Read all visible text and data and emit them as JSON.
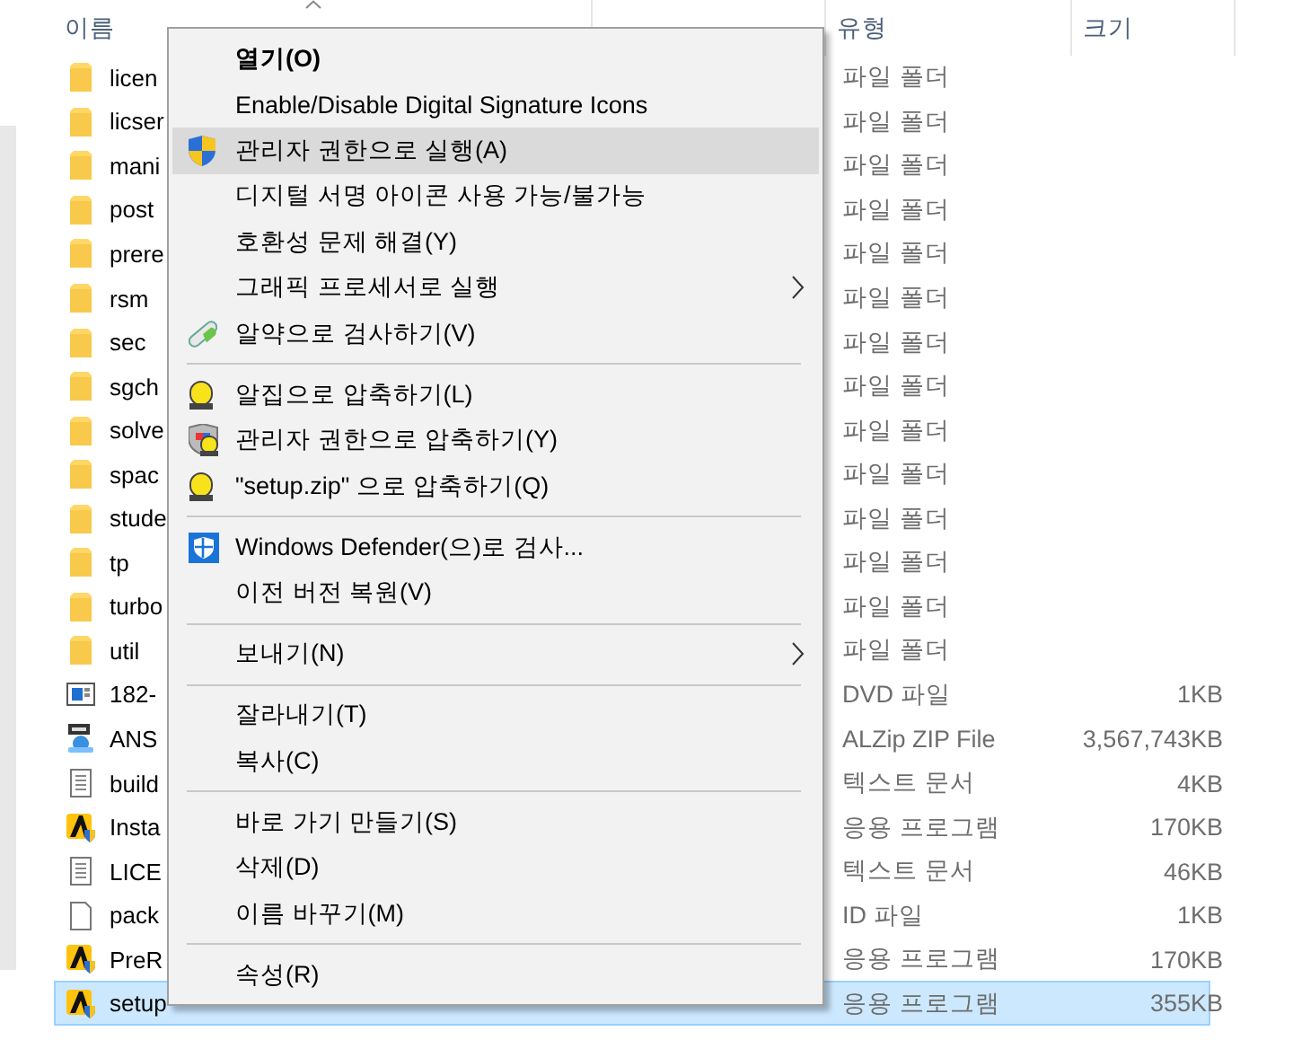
{
  "columns": [
    {
      "kind": "name",
      "label": "이름",
      "sorted": true
    },
    {
      "kind": "date",
      "sorted": false
    },
    {
      "kind": "type",
      "label": "유형",
      "sorted": false
    },
    {
      "kind": "size",
      "label": "크기",
      "sorted": false
    }
  ],
  "files": [
    {
      "name": "licen",
      "kind": "folder",
      "type": "파일 폴더",
      "selected": false
    },
    {
      "name": "licser",
      "kind": "folder",
      "type": "파일 폴더",
      "selected": false
    },
    {
      "name": "mani",
      "kind": "folder",
      "type": "파일 폴더",
      "selected": false
    },
    {
      "name": "post",
      "kind": "folder",
      "type": "파일 폴더",
      "selected": false
    },
    {
      "name": "prere",
      "kind": "folder",
      "type": "파일 폴더",
      "selected": false
    },
    {
      "name": "rsm",
      "kind": "folder",
      "type": "파일 폴더",
      "selected": false
    },
    {
      "name": "sec",
      "kind": "folder",
      "type": "파일 폴더",
      "selected": false
    },
    {
      "name": "sgch",
      "kind": "folder",
      "type": "파일 폴더",
      "selected": false
    },
    {
      "name": "solve",
      "kind": "folder",
      "type": "파일 폴더",
      "selected": false
    },
    {
      "name": "spac",
      "kind": "folder",
      "type": "파일 폴더",
      "selected": false
    },
    {
      "name": "stude",
      "kind": "folder",
      "type": "파일 폴더",
      "selected": false
    },
    {
      "name": "tp",
      "kind": "folder",
      "type": "파일 폴더",
      "selected": false
    },
    {
      "name": "turbo",
      "kind": "folder",
      "type": "파일 폴더",
      "selected": false
    },
    {
      "name": "util",
      "kind": "folder",
      "type": "파일 폴더",
      "selected": false
    },
    {
      "name": "182-",
      "kind": "dvd",
      "type": "DVD 파일",
      "size": "1KB",
      "selected": false
    },
    {
      "name": "ANS",
      "kind": "zip",
      "type": "ALZip ZIP File",
      "size": "3,567,743KB",
      "selected": false
    },
    {
      "name": "build",
      "kind": "text",
      "type": "텍스트 문서",
      "size": "4KB",
      "selected": false
    },
    {
      "name": "Insta",
      "kind": "app",
      "type": "응용 프로그램",
      "size": "170KB",
      "selected": false
    },
    {
      "name": "LICE",
      "kind": "text",
      "type": "텍스트 문서",
      "size": "46KB",
      "selected": false
    },
    {
      "name": "pack",
      "kind": "blank",
      "type": "ID 파일",
      "size": "1KB",
      "selected": false
    },
    {
      "name": "PreR",
      "kind": "app",
      "type": "응용 프로그램",
      "size": "170KB",
      "selected": false
    },
    {
      "name": "setup",
      "kind": "app",
      "type": "응용 프로그램",
      "size": "355KB",
      "selected": true
    }
  ],
  "context_menu": {
    "items": [
      {
        "kind": "plain",
        "label": "열기(O)",
        "bold": true,
        "highlighted": false
      },
      {
        "kind": "plain",
        "label": "Enable/Disable Digital Signature Icons",
        "highlighted": false
      },
      {
        "kind": "shield",
        "label": "관리자 권한으로 실행(A)",
        "highlighted": true
      },
      {
        "kind": "plain",
        "label": "디지털 서명 아이콘 사용 가능/불가능",
        "highlighted": false
      },
      {
        "kind": "plain",
        "label": "호환성 문제 해결(Y)",
        "highlighted": false
      },
      {
        "kind": "plain",
        "label": "그래픽 프로세서로 실행",
        "submenu": true,
        "highlighted": false
      },
      {
        "kind": "pill",
        "label": "알약으로 검사하기(V)",
        "highlighted": false
      },
      {
        "kind": "separator"
      },
      {
        "kind": "alzip",
        "label": "알집으로 압축하기(L)",
        "highlighted": false
      },
      {
        "kind": "alzip-shield",
        "label": "관리자 권한으로 압축하기(Y)",
        "highlighted": false
      },
      {
        "kind": "alzip",
        "label": "\"setup.zip\" 으로 압축하기(Q)",
        "highlighted": false
      },
      {
        "kind": "separator"
      },
      {
        "kind": "defender",
        "label": "Windows Defender(으)로 검사...",
        "highlighted": false
      },
      {
        "kind": "plain",
        "label": "이전 버전 복원(V)",
        "highlighted": false
      },
      {
        "kind": "separator"
      },
      {
        "kind": "plain",
        "label": "보내기(N)",
        "submenu": true,
        "highlighted": false
      },
      {
        "kind": "separator"
      },
      {
        "kind": "plain",
        "label": "잘라내기(T)",
        "highlighted": false
      },
      {
        "kind": "plain",
        "label": "복사(C)",
        "highlighted": false
      },
      {
        "kind": "separator"
      },
      {
        "kind": "plain",
        "label": "바로 가기 만들기(S)",
        "highlighted": false
      },
      {
        "kind": "plain",
        "label": "삭제(D)",
        "highlighted": false
      },
      {
        "kind": "plain",
        "label": "이름 바꾸기(M)",
        "highlighted": false
      },
      {
        "kind": "separator"
      },
      {
        "kind": "plain",
        "label": "속성(R)",
        "highlighted": false
      }
    ]
  }
}
